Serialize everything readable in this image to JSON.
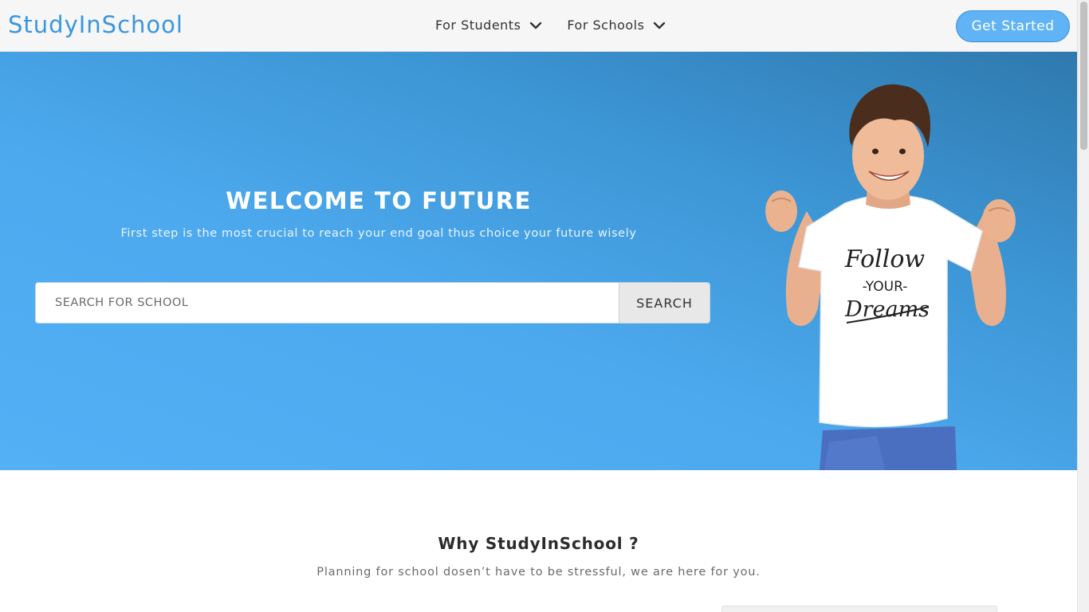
{
  "nav": {
    "brand": "StudyInSchool",
    "items": [
      {
        "label": "For Students",
        "icon": "chevron-down-icon"
      },
      {
        "label": "For Schools",
        "icon": "chevron-down-icon"
      }
    ],
    "cta_label": "Get Started"
  },
  "hero": {
    "title": "WELCOME TO FUTURE",
    "subtitle": "First step is the most crucial to reach your end goal thus choice your future wisely",
    "search": {
      "placeholder": "SEARCH FOR SCHOOL",
      "value": "",
      "button_label": "SEARCH"
    },
    "shirt_text": [
      "Follow",
      "-YOUR-",
      "Dreams"
    ]
  },
  "why": {
    "title": "Why StudyInSchool ?",
    "subtitle": "Planning for school dosen’t have to be stressful, we are here for you."
  },
  "colors": {
    "brand": "#3a96df",
    "cta": "#60b3f5",
    "hero_top": "#2f79ae",
    "hero_bottom": "#54b0f5"
  }
}
